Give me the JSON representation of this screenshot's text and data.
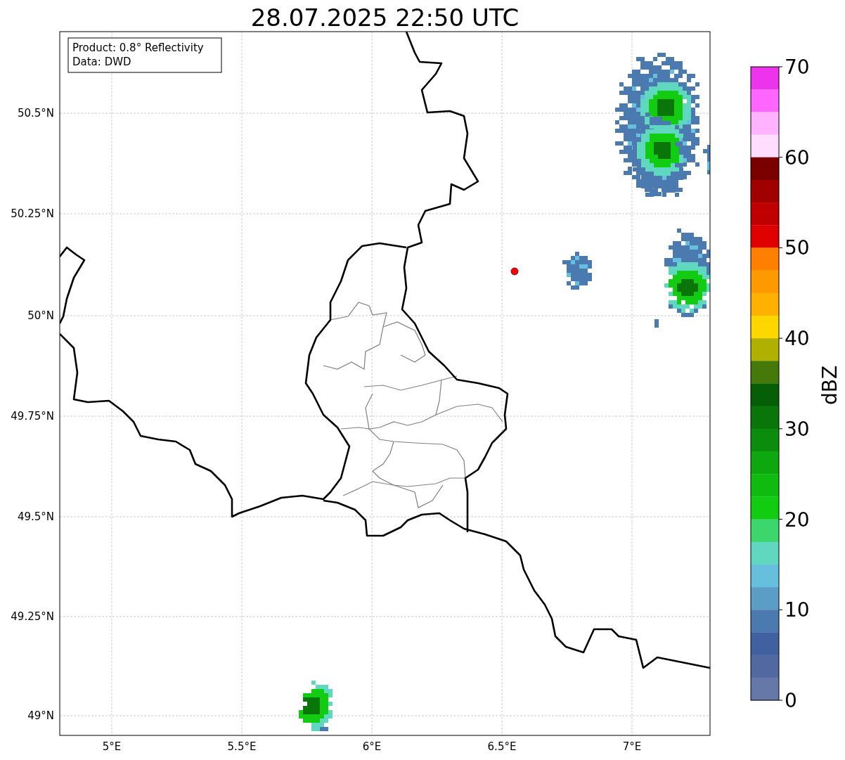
{
  "title": "28.07.2025 22:50 UTC",
  "info_box": [
    "Product: 0.8° Reflectivity",
    "Data: DWD"
  ],
  "lat_ticks": [
    "50.5°N",
    "50.25°N",
    "50°N",
    "49.75°N",
    "49.5°N",
    "49.25°N",
    "49°N"
  ],
  "lon_ticks": [
    "5°E",
    "5.5°E",
    "6°E",
    "6.5°E",
    "7°E"
  ],
  "colorbar": {
    "label": "dBZ",
    "ticks": [
      "70",
      "60",
      "50",
      "40",
      "30",
      "20",
      "10",
      "0"
    ],
    "bins": [
      {
        "color": "#ee33ee"
      },
      {
        "color": "#ff66ff"
      },
      {
        "color": "#ffb3ff"
      },
      {
        "color": "#ffddff"
      },
      {
        "color": "#7a0000"
      },
      {
        "color": "#a00000"
      },
      {
        "color": "#c00000"
      },
      {
        "color": "#e00000"
      },
      {
        "color": "#ff7f00"
      },
      {
        "color": "#ff9900"
      },
      {
        "color": "#ffb000"
      },
      {
        "color": "#ffd700"
      },
      {
        "color": "#b0b000"
      },
      {
        "color": "#457a0a"
      },
      {
        "color": "#065e06"
      },
      {
        "color": "#0a760a"
      },
      {
        "color": "#0c8c0c"
      },
      {
        "color": "#0ea80e"
      },
      {
        "color": "#10bb10"
      },
      {
        "color": "#12cc12"
      },
      {
        "color": "#3cd66c"
      },
      {
        "color": "#60d8c0"
      },
      {
        "color": "#66c0dd"
      },
      {
        "color": "#5a9ec6"
      },
      {
        "color": "#4a7ab0"
      },
      {
        "color": "#4060a0"
      },
      {
        "color": "#5268a0"
      },
      {
        "color": "#6678a8"
      }
    ]
  }
}
